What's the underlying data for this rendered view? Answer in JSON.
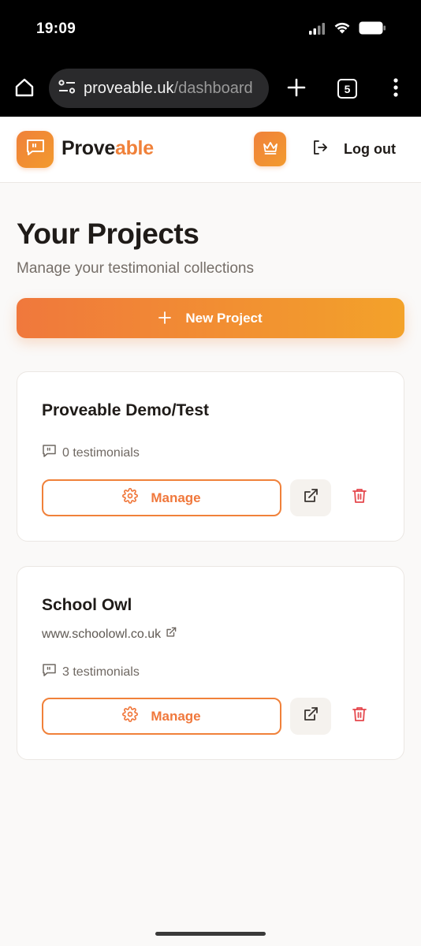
{
  "status_bar": {
    "time": "19:09",
    "icons": [
      "signal-icon",
      "wifi-icon",
      "battery-icon"
    ]
  },
  "browser": {
    "url_host": "proveable.uk",
    "url_path": "/dashboard",
    "tab_count": "5",
    "icons": [
      "home-icon",
      "site-settings-icon",
      "plus-icon",
      "more-vert-icon"
    ]
  },
  "header": {
    "brand_part1": "Prove",
    "brand_part2": "able",
    "logout_label": "Log out",
    "icons": [
      "chat-quote-icon",
      "crown-icon",
      "logout-icon"
    ]
  },
  "main": {
    "title": "Your Projects",
    "subtitle": "Manage your testimonial collections",
    "new_project_label": "New Project"
  },
  "projects": [
    {
      "name": "Proveable Demo/Test",
      "url": "",
      "testimonials": "0 testimonials",
      "manage_label": "Manage"
    },
    {
      "name": "School Owl",
      "url": "www.schoolowl.co.uk",
      "testimonials": "3 testimonials",
      "manage_label": "Manage"
    }
  ],
  "colors": {
    "brand_orange": "#f0813a",
    "brand_orange_light": "#f3a22a",
    "danger_red": "#e5484d",
    "background": "#faf9f8"
  }
}
